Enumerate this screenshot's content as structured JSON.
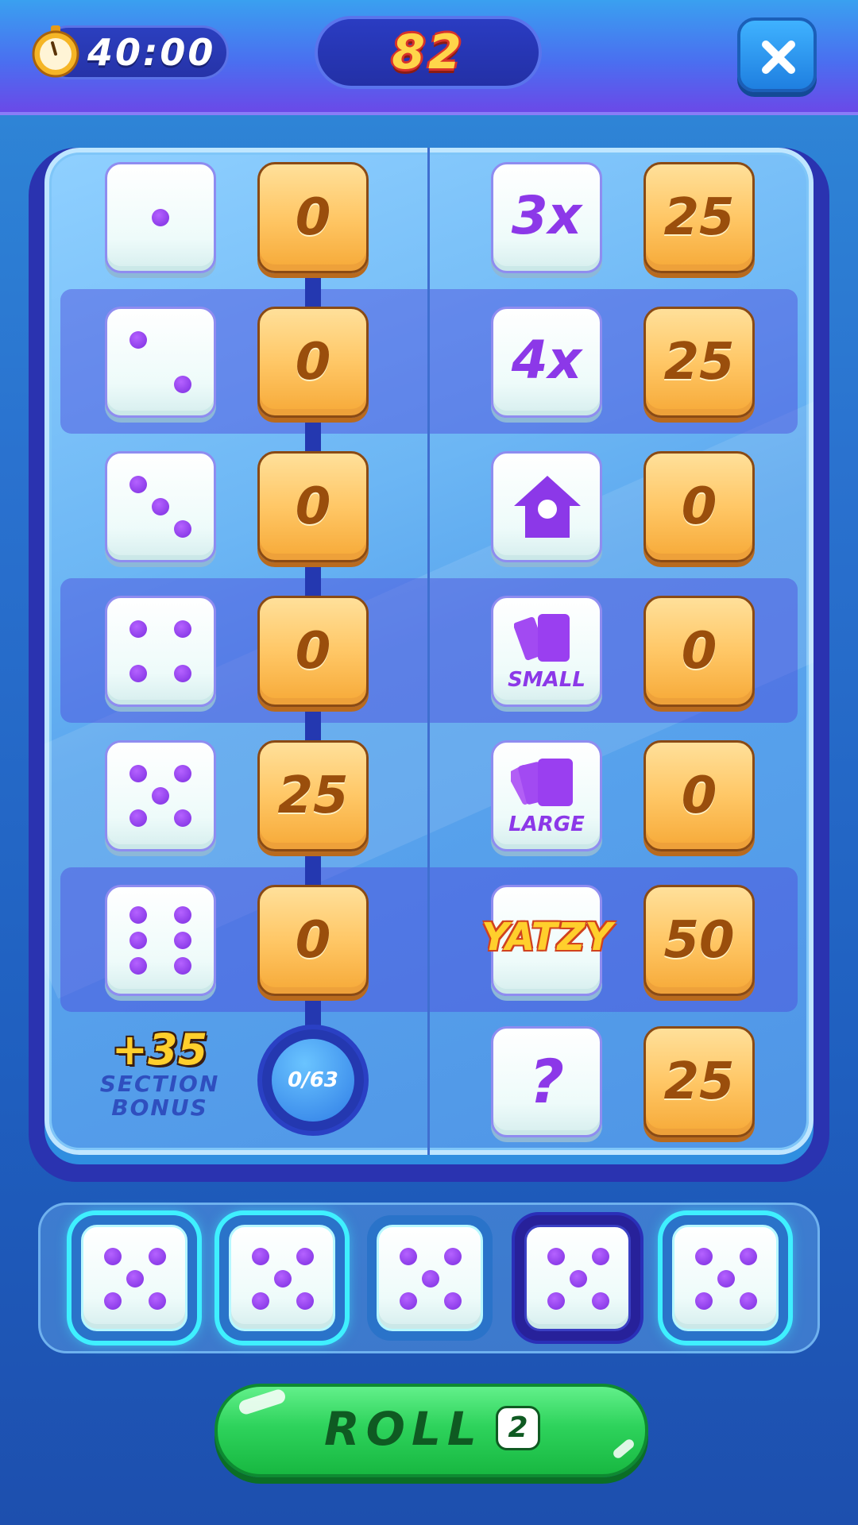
{
  "header": {
    "timer": "40:00",
    "score": "82"
  },
  "board": {
    "upper": [
      {
        "category": "ones",
        "die_face": 1,
        "score": "0"
      },
      {
        "category": "twos",
        "die_face": 2,
        "score": "0"
      },
      {
        "category": "threes",
        "die_face": 3,
        "score": "0"
      },
      {
        "category": "fours",
        "die_face": 4,
        "score": "0"
      },
      {
        "category": "fives",
        "die_face": 5,
        "score": "25"
      },
      {
        "category": "sixes",
        "die_face": 6,
        "score": "0"
      }
    ],
    "lower": [
      {
        "category": "three-of-a-kind",
        "icon_text": "3x",
        "score": "25"
      },
      {
        "category": "four-of-a-kind",
        "icon_text": "4x",
        "score": "25"
      },
      {
        "category": "full-house",
        "icon": "house-icon",
        "score": "0"
      },
      {
        "category": "small-straight",
        "icon": "cards-icon",
        "icon_text": "SMALL",
        "score": "0"
      },
      {
        "category": "large-straight",
        "icon": "cards-icon",
        "icon_text": "LARGE",
        "score": "0"
      },
      {
        "category": "yatzy",
        "icon_text": "YATZY",
        "score": "50"
      },
      {
        "category": "chance",
        "icon_text": "?",
        "score": "25"
      }
    ],
    "bonus": {
      "value": "+35",
      "label_line1": "SECTION",
      "label_line2": "BONUS",
      "progress": "0/63"
    }
  },
  "tray": {
    "dice": [
      {
        "face": 5,
        "state": "active"
      },
      {
        "face": 5,
        "state": "active"
      },
      {
        "face": 5,
        "state": "active"
      },
      {
        "face": 5,
        "state": "held"
      },
      {
        "face": 5,
        "state": "active"
      }
    ]
  },
  "roll_button": {
    "label": "ROLL",
    "rolls_left": "2"
  },
  "colors": {
    "pip": "#8c38e8",
    "score_tile": "#ffc766",
    "score_text": "#9a4e0c",
    "roll_button": "#2ed35c",
    "score_counter": "#ffd54a"
  }
}
